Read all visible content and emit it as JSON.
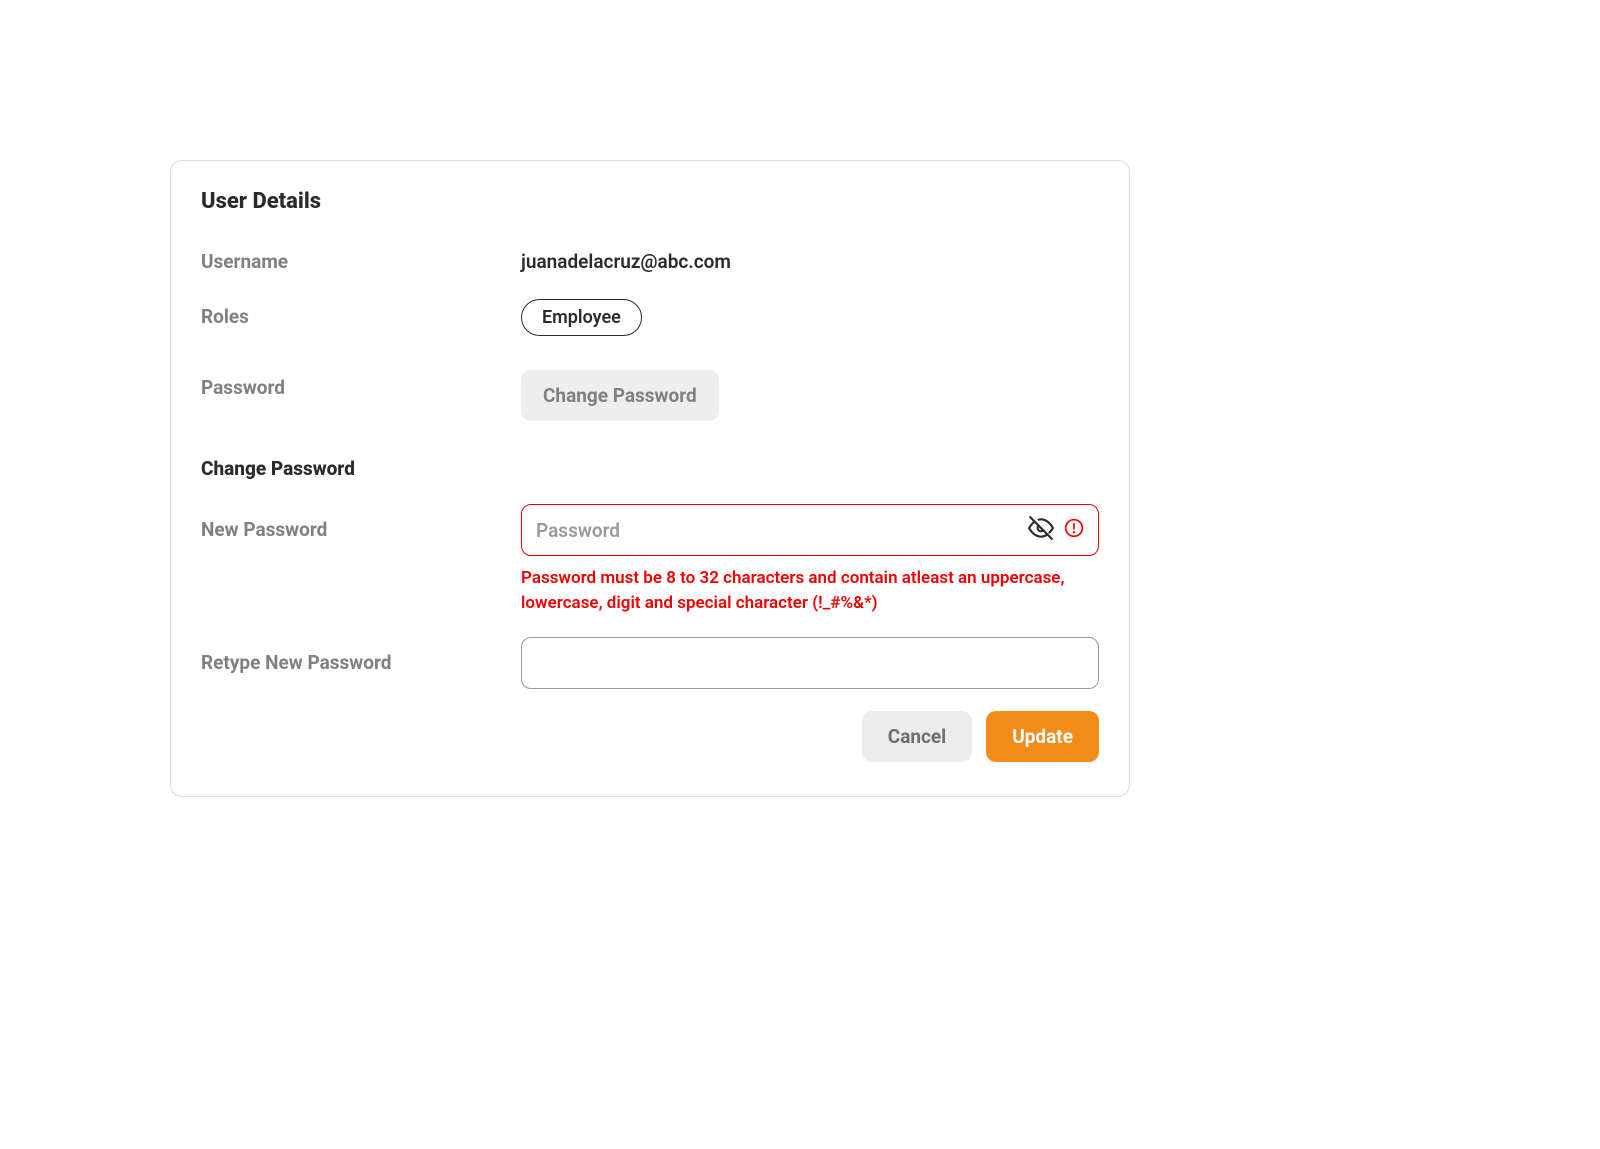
{
  "card": {
    "title": "User Details",
    "username_label": "Username",
    "username_value": "juanadelacruz@abc.com",
    "roles_label": "Roles",
    "roles_value": "Employee",
    "password_label": "Password",
    "change_password_btn": "Change Password",
    "change_password_heading": "Change Password",
    "new_password_label": "New Password",
    "new_password_placeholder": "Password",
    "new_password_value": "",
    "new_password_error": "Password must be 8 to 32 characters and contain atleast an uppercase, lowercase, digit and special character (!_#%&*)",
    "retype_password_label": "Retype New Password",
    "retype_password_value": "",
    "cancel_label": "Cancel",
    "update_label": "Update"
  },
  "colors": {
    "error": "#ef0000",
    "accent": "#f28c18",
    "muted": "#808080",
    "text": "#2b2b2b"
  }
}
